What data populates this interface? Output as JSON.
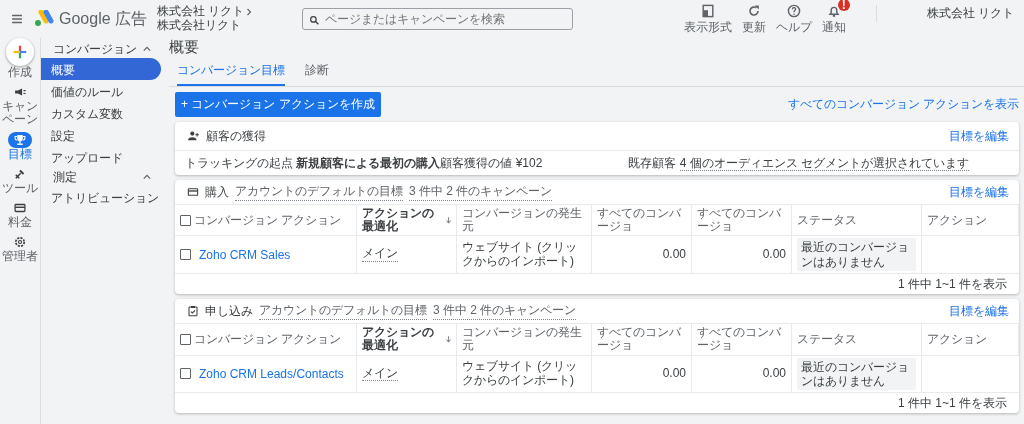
{
  "header": {
    "product": "Google 広告",
    "breadcrumb_parent": "株式会社 リクト",
    "account_name": "株式会社リクト",
    "search": {
      "placeholder": "ページまたはキャンペーンを検索"
    },
    "tools": [
      {
        "kind": "appearance",
        "label": "表示形式"
      },
      {
        "kind": "refresh",
        "label": "更新"
      },
      {
        "kind": "help",
        "label": "ヘルプ"
      },
      {
        "kind": "bell",
        "label": "通知",
        "badge": "!"
      }
    ],
    "user": "株式会社 リクト"
  },
  "rail": [
    {
      "kind": "create",
      "label": "作成"
    },
    {
      "kind": "megaphone",
      "label": "キャンペーン",
      "selected": false
    },
    {
      "kind": "trophy",
      "label": "目標",
      "selected": true
    },
    {
      "kind": "tools",
      "label": "ツール",
      "selected": false
    },
    {
      "kind": "billing",
      "label": "料金",
      "selected": false
    },
    {
      "kind": "admin",
      "label": "管理者",
      "selected": false
    }
  ],
  "sidebar": [
    {
      "label": "コンバージョン",
      "expanded": true,
      "children": [
        {
          "label": "概要",
          "selected": true
        },
        {
          "label": "価値のルール",
          "selected": false
        },
        {
          "label": "カスタム変数",
          "selected": false
        },
        {
          "label": "設定",
          "selected": false
        },
        {
          "label": "アップロード",
          "selected": false
        }
      ]
    },
    {
      "label": "測定",
      "expanded": true,
      "children": [
        {
          "label": "アトリビューション",
          "selected": false
        }
      ]
    }
  ],
  "page_title": "概要",
  "tabs": [
    {
      "label": "コンバージョン目標",
      "selected": true
    },
    {
      "label": "診断",
      "selected": false
    }
  ],
  "create_button": "+ コンバージョン アクションを作成",
  "view_all_link": "すべてのコンバージョン アクションを表示",
  "acquisition_card": {
    "title": "顧客の獲得",
    "edit_link": "目標を編集",
    "details": [
      {
        "label": "トラッキングの起点",
        "value": "新規顧客による最初の購入",
        "kind": "bold"
      },
      {
        "label": "顧客獲得の値",
        "value": "¥102",
        "kind": "plain"
      },
      {
        "label": "既存顧客",
        "value": "4 個のオーディエンス セグメントが選択されています",
        "kind": "dotted"
      }
    ]
  },
  "goal_cards": [
    {
      "kind": "purchase",
      "title": "購入",
      "default_goal": "アカウントのデフォルトの目標",
      "campaigns": "3 件中 2 件のキャンペーン",
      "edit_link": "目標を編集",
      "columns": [
        {
          "label": "コンバージョン アクション",
          "sorted": false
        },
        {
          "label": "アクションの最適化",
          "sorted": true
        },
        {
          "label": "コンバージョンの発生元",
          "sorted": false
        },
        {
          "label": "すべてのコンバージョ",
          "sorted": false
        },
        {
          "label": "すべてのコンバージョ",
          "sorted": false
        },
        {
          "label": "ステータス",
          "sorted": false
        },
        {
          "label": "アクション",
          "sorted": false
        }
      ],
      "rows": [
        {
          "checked": false,
          "name": "Zoho CRM Sales",
          "optimization": "メイン",
          "source": "ウェブサイト (クリックからのインポート)",
          "all_conv_1": "0.00",
          "all_conv_2": "0.00",
          "status": "最近のコンバージョンはありません"
        }
      ],
      "pagination": "1 件中 1~1 件を表示"
    },
    {
      "kind": "signup",
      "title": "申し込み",
      "default_goal": "アカウントのデフォルトの目標",
      "campaigns": "3 件中 2 件のキャンペーン",
      "edit_link": "目標を編集",
      "columns": [
        {
          "label": "コンバージョン アクション",
          "sorted": false
        },
        {
          "label": "アクションの最適化",
          "sorted": true
        },
        {
          "label": "コンバージョンの発生元",
          "sorted": false
        },
        {
          "label": "すべてのコンバージョ",
          "sorted": false
        },
        {
          "label": "すべてのコンバージョ",
          "sorted": false
        },
        {
          "label": "ステータス",
          "sorted": false
        },
        {
          "label": "アクション",
          "sorted": false
        }
      ],
      "rows": [
        {
          "checked": false,
          "name": "Zoho CRM Leads/Contacts",
          "optimization": "メイン",
          "source": "ウェブサイト (クリックからのインポート)",
          "all_conv_1": "0.00",
          "all_conv_2": "0.00",
          "status": "最近のコンバージョンはありません"
        }
      ],
      "pagination": "1 件中 1~1 件を表示"
    }
  ]
}
